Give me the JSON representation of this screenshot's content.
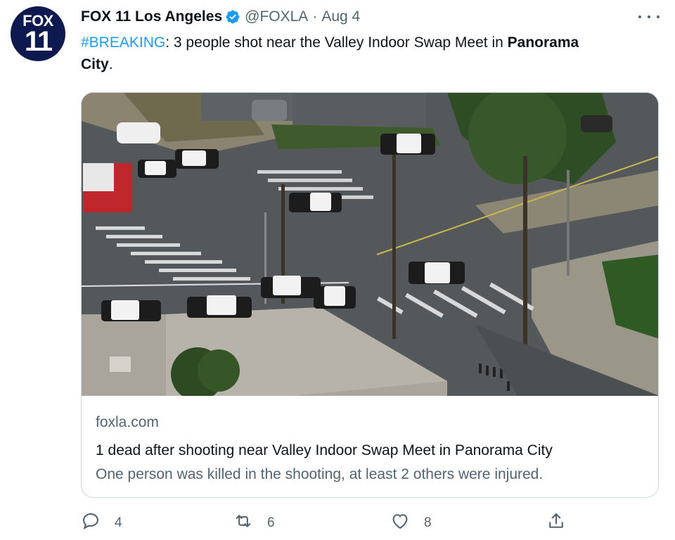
{
  "account": {
    "avatar_text_top": "FOX",
    "avatar_text_bottom": "11",
    "name": "FOX 11 Los Angeles",
    "handle": "@FOXLA",
    "separator": "·",
    "date": "Aug 4",
    "verified": true
  },
  "tweet": {
    "hashtag": "#BREAKING",
    "text_middle": ": 3 people shot near the Valley Indoor Swap Meet in ",
    "place_bold_1": "Panorama",
    "place_bold_2": "City",
    "text_end": "."
  },
  "card": {
    "image_description_icon": "aerial-crime-scene-photo",
    "domain": "foxla.com",
    "title": "1 dead after shooting near Valley Indoor Swap Meet in Panorama City",
    "description": "One person was killed in the shooting, at least 2 others were injured."
  },
  "actions": {
    "reply_count": "4",
    "retweet_count": "6",
    "like_count": "8",
    "share_icon": "share-icon"
  },
  "colors": {
    "link": "#1d9bf0",
    "secondary": "#536471",
    "text": "#0f1419",
    "border": "#cfd9de",
    "avatar_bg": "#0e1a4f"
  }
}
